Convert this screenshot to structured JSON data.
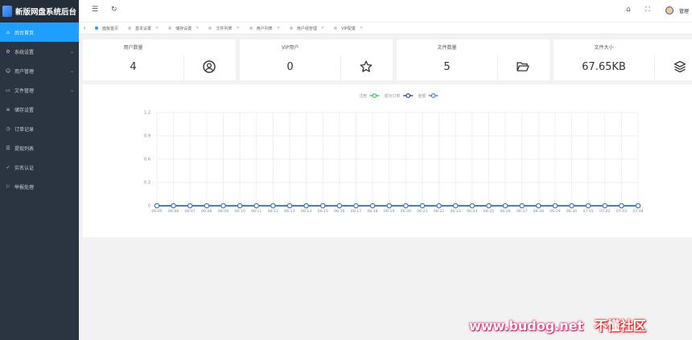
{
  "app": {
    "title": "新版网盘系统后台"
  },
  "sidebar": {
    "items": [
      {
        "label": "后台首页",
        "icon": "home-icon",
        "active": true,
        "expandable": false
      },
      {
        "label": "系统设置",
        "icon": "gear-icon",
        "active": false,
        "expandable": true
      },
      {
        "label": "用户管理",
        "icon": "user-icon",
        "active": false,
        "expandable": true
      },
      {
        "label": "文件管理",
        "icon": "folder-icon",
        "active": false,
        "expandable": true
      },
      {
        "label": "储存设置",
        "icon": "storage-icon",
        "active": false,
        "expandable": false
      },
      {
        "label": "订单记录",
        "icon": "order-icon",
        "active": false,
        "expandable": false
      },
      {
        "label": "提现列表",
        "icon": "list-icon",
        "active": false,
        "expandable": false
      },
      {
        "label": "实名认证",
        "icon": "verify-icon",
        "active": false,
        "expandable": false
      },
      {
        "label": "举报处理",
        "icon": "report-icon",
        "active": false,
        "expandable": false
      }
    ]
  },
  "topbar": {
    "user_label": "管理"
  },
  "tabs": [
    {
      "label": "面板首页",
      "active": true
    },
    {
      "label": "基本设置",
      "active": false
    },
    {
      "label": "储存设置",
      "active": false
    },
    {
      "label": "文件列表",
      "active": false
    },
    {
      "label": "用户列表",
      "active": false
    },
    {
      "label": "用户组管理",
      "active": false
    },
    {
      "label": "VIP配置",
      "active": false
    }
  ],
  "cards": [
    {
      "title": "用户数量",
      "value": "4",
      "icon": "user-circle-icon"
    },
    {
      "title": "VIP用户",
      "value": "0",
      "icon": "star-icon"
    },
    {
      "title": "文件数量",
      "value": "5",
      "icon": "folder-open-icon"
    },
    {
      "title": "文件大小",
      "value": "67.65KB",
      "icon": "layers-icon"
    }
  ],
  "chart_data": {
    "type": "line",
    "legend_position": "top-center",
    "grid": true,
    "ylim": [
      0,
      1.2
    ],
    "yticks": [
      "0",
      "0.3",
      "0.6",
      "0.9",
      "1.2"
    ],
    "categories": [
      "06-05",
      "06-06",
      "06-07",
      "06-08",
      "06-09",
      "06-10",
      "06-11",
      "06-12",
      "06-13",
      "06-14",
      "06-15",
      "06-16",
      "06-17",
      "06-18",
      "06-19",
      "06-20",
      "06-21",
      "06-22",
      "06-23",
      "06-24",
      "06-25",
      "06-26",
      "06-27",
      "06-28",
      "06-29",
      "06-30",
      "07-01",
      "07-02",
      "07-03",
      "07-04"
    ],
    "series": [
      {
        "name": "注册",
        "color": "#2fc25b",
        "values": [
          0,
          0,
          0,
          0,
          0,
          0,
          0,
          0,
          0,
          0,
          0,
          0,
          0,
          0,
          0,
          0,
          0,
          0,
          0,
          0,
          0,
          0,
          0,
          0,
          0,
          0,
          0,
          0,
          0,
          0
        ]
      },
      {
        "name": "成功订单",
        "color": "#1e3a8a",
        "values": [
          0,
          0,
          0,
          0,
          0,
          0,
          0,
          0,
          0,
          0,
          0,
          0,
          0,
          0,
          0,
          0,
          0,
          0,
          0,
          0,
          0,
          0,
          0,
          0,
          0,
          0,
          0,
          0,
          0,
          0
        ]
      },
      {
        "name": "金额",
        "color": "#3a7bd5",
        "values": [
          0,
          0,
          0,
          0,
          0,
          0,
          0,
          0,
          0,
          0,
          0,
          0,
          0,
          0,
          0,
          0,
          0,
          0,
          0,
          0,
          0,
          0,
          0,
          0,
          0,
          0,
          0,
          0,
          0,
          0
        ]
      }
    ]
  },
  "watermark": {
    "domain": "www.budog.net",
    "name": "不懂社区"
  }
}
